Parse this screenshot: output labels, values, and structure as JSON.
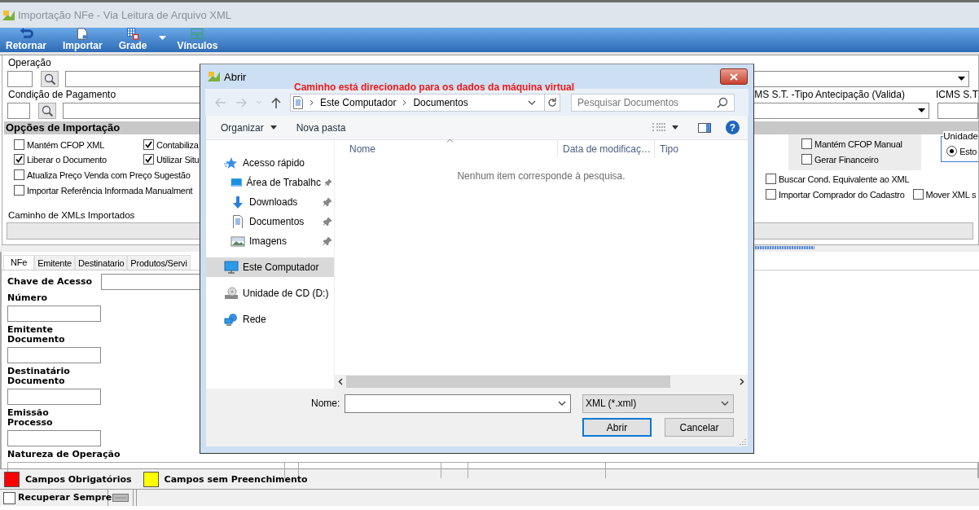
{
  "window": {
    "title": "Importação NFe - Via Leitura de Arquivo XML"
  },
  "toolbar": [
    {
      "label": "Retornar",
      "kind": "back",
      "dropdown": false
    },
    {
      "label": "Importar",
      "kind": "import",
      "dropdown": false
    },
    {
      "label": "Grade",
      "kind": "grid",
      "dropdown": true
    },
    {
      "label": "Vínculos",
      "kind": "links",
      "dropdown": false
    }
  ],
  "header_fields": {
    "operacao": "Operação",
    "condicao_pagamento": "Condição de Pagamento",
    "icms_st_tipo": "MS S.T. -Tipo Antecipação (Valida)",
    "icms_st": "ICMS S.T"
  },
  "import_options": {
    "title": "Opções de Importação",
    "left_grid": [
      {
        "label": "Mantém CFOP XML",
        "checked": false
      },
      {
        "label": "Contabiliza",
        "checked": true
      },
      {
        "label": "Liberar o Documento",
        "checked": true
      },
      {
        "label": "Utilizar Situ",
        "checked": true
      }
    ],
    "left_rows": [
      {
        "label": "Atualiza Preço Venda com Preço Sugestão",
        "checked": false
      },
      {
        "label": "Importar Referência Informada Manualment",
        "checked": false
      }
    ],
    "group": [
      {
        "label": "Mantém CFOP Manual",
        "checked": false
      },
      {
        "label": "Gerar Financeiro",
        "checked": false
      }
    ],
    "unit": {
      "title": "Unidade",
      "options": [
        {
          "label": "Esto",
          "selected": true
        }
      ]
    },
    "right_rows": [
      [
        {
          "label": "Buscar Cond. Equivalente ao XML",
          "checked": false
        }
      ],
      [
        {
          "label": "Importar Comprador do Cadastro",
          "checked": false
        },
        {
          "label": "Mover XML s",
          "checked": false
        }
      ]
    ],
    "path_label": "Caminho de XMLs Importados"
  },
  "tabs": [
    {
      "label": "NFe",
      "selected": true
    },
    {
      "label": "Emitente",
      "selected": false
    },
    {
      "label": "Destinatario",
      "selected": false
    },
    {
      "label": "Produtos/Servi",
      "selected": false
    }
  ],
  "nfe_fields": [
    {
      "kind": "inline",
      "label": "Chave de Acesso"
    },
    {
      "kind": "stacked",
      "label": "Número"
    },
    {
      "kind": "stacked",
      "label": "Emitente",
      "sublabel": "Documento"
    },
    {
      "kind": "stacked",
      "label": "Destinatário",
      "sublabel": "Documento"
    },
    {
      "kind": "stacked",
      "label": "Emissão",
      "sublabel": "Processo"
    },
    {
      "kind": "grid",
      "label": "Natureza de Operação"
    }
  ],
  "legend": [
    {
      "label": "Campos Obrigatórios",
      "color": "#ff0000"
    },
    {
      "label": "Campos sem Preenchimento",
      "color": "#ffff00"
    }
  ],
  "status_bar": {
    "label": "Recuperar Sempre",
    "checked": false
  },
  "dialog": {
    "title": "Abrir",
    "note": "Caminho está direcionado para os dados da máquina virtual",
    "breadcrumb": [
      "Este Computador",
      "Documentos"
    ],
    "search_placeholder": "Pesquisar Documentos",
    "organize": "Organizar",
    "new_folder": "Nova pasta",
    "help": "?",
    "nav": [
      {
        "label": "Acesso rápido",
        "kind": "star",
        "selected": false,
        "children": [
          {
            "label": "Área de Trabalhc",
            "kind": "desktop",
            "pinned": true,
            "selected": false
          },
          {
            "label": "Downloads",
            "kind": "download",
            "pinned": true,
            "selected": false
          },
          {
            "label": "Documentos",
            "kind": "document",
            "pinned": true,
            "selected": false
          },
          {
            "label": "Imagens",
            "kind": "image",
            "pinned": true,
            "selected": false
          }
        ]
      },
      {
        "label": "Este Computador",
        "kind": "computer",
        "selected": true
      },
      {
        "label": "Unidade de CD (D:)",
        "kind": "cd",
        "selected": false
      },
      {
        "label": "Rede",
        "kind": "network",
        "selected": false
      }
    ],
    "columns": [
      "Nome",
      "Data de modificaç…",
      "Tipo"
    ],
    "empty_message": "Nenhum item corresponde à pesquisa.",
    "filename_label": "Nome:",
    "filter": "XML (*.xml)",
    "buttons": [
      {
        "label": "Abrir",
        "default": true
      },
      {
        "label": "Cancelar",
        "default": false
      }
    ]
  }
}
